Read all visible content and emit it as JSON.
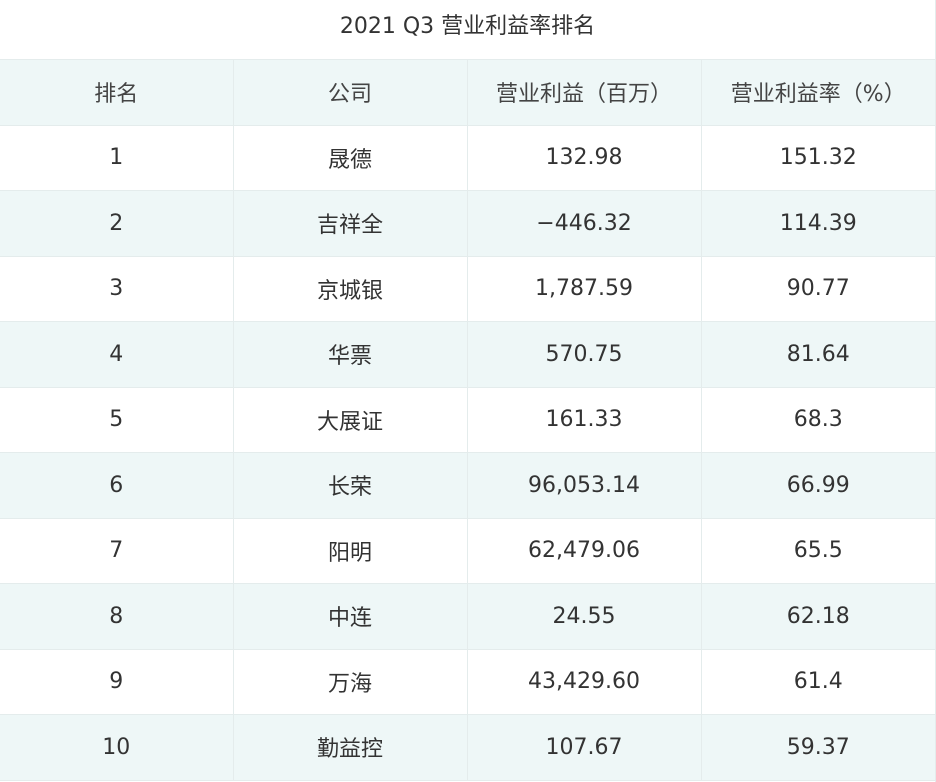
{
  "title": "2021 Q3 营业利益率排名",
  "headers": [
    "排名",
    "公司",
    "营业利益（百万）",
    "营业利益率（%）"
  ],
  "rows": [
    [
      "1",
      "晟德",
      "132.98",
      "151.32"
    ],
    [
      "2",
      "吉祥全",
      "−446.32",
      "114.39"
    ],
    [
      "3",
      "京城银",
      "1,787.59",
      "90.77"
    ],
    [
      "4",
      "华票",
      "570.75",
      "81.64"
    ],
    [
      "5",
      "大展证",
      "161.33",
      "68.3"
    ],
    [
      "6",
      "长荣",
      "96,053.14",
      "66.99"
    ],
    [
      "7",
      "阳明",
      "62,479.06",
      "65.5"
    ],
    [
      "8",
      "中连",
      "24.55",
      "62.18"
    ],
    [
      "9",
      "万海",
      "43,429.60",
      "61.4"
    ],
    [
      "10",
      "勤益控",
      "107.67",
      "59.37"
    ]
  ]
}
